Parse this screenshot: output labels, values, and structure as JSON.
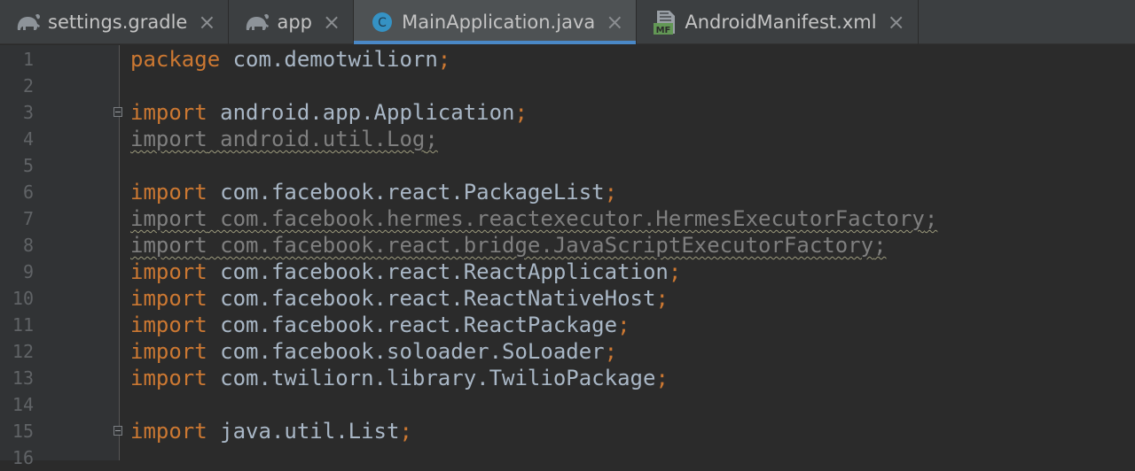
{
  "tabs": [
    {
      "label": "settings.gradle",
      "icon": "gradle-elephant-icon",
      "active": false
    },
    {
      "label": "app",
      "icon": "gradle-elephant-icon",
      "active": false
    },
    {
      "label": "MainApplication.java",
      "icon": "java-class-icon",
      "icon_text": "C",
      "active": true
    },
    {
      "label": "AndroidManifest.xml",
      "icon": "manifest-file-icon",
      "icon_text": "MF",
      "active": false
    }
  ],
  "colors": {
    "background": "#2b2b2b",
    "gutter": "#313335",
    "keyword": "#cc7832",
    "identifier": "#a9b7c6",
    "unused": "#7f7f7f",
    "line_number": "#606366",
    "active_tab_underline": "#4a88c7"
  },
  "editor": {
    "lines": [
      {
        "n": "1",
        "kw": "package",
        "id": " com.demotwiliorn",
        "punct": ";",
        "unused": false,
        "fold": false
      },
      {
        "n": "2",
        "kw": "",
        "id": "",
        "punct": "",
        "unused": false,
        "fold": false
      },
      {
        "n": "3",
        "kw": "import",
        "id": " android.app.Application",
        "punct": ";",
        "unused": false,
        "fold": true
      },
      {
        "n": "4",
        "kw": "import",
        "id": " android.util.Log",
        "punct": ";",
        "unused": true,
        "fold": false
      },
      {
        "n": "5",
        "kw": "",
        "id": "",
        "punct": "",
        "unused": false,
        "fold": false
      },
      {
        "n": "6",
        "kw": "import",
        "id": " com.facebook.react.PackageList",
        "punct": ";",
        "unused": false,
        "fold": false
      },
      {
        "n": "7",
        "kw": "import",
        "id": " com.facebook.hermes.reactexecutor.HermesExecutorFactory",
        "punct": ";",
        "unused": true,
        "fold": false
      },
      {
        "n": "8",
        "kw": "import",
        "id": " com.facebook.react.bridge.JavaScriptExecutorFactory",
        "punct": ";",
        "unused": true,
        "fold": false
      },
      {
        "n": "9",
        "kw": "import",
        "id": " com.facebook.react.ReactApplication",
        "punct": ";",
        "unused": false,
        "fold": false
      },
      {
        "n": "10",
        "kw": "import",
        "id": " com.facebook.react.ReactNativeHost",
        "punct": ";",
        "unused": false,
        "fold": false
      },
      {
        "n": "11",
        "kw": "import",
        "id": " com.facebook.react.ReactPackage",
        "punct": ";",
        "unused": false,
        "fold": false
      },
      {
        "n": "12",
        "kw": "import",
        "id": " com.facebook.soloader.SoLoader",
        "punct": ";",
        "unused": false,
        "fold": false
      },
      {
        "n": "13",
        "kw": "import",
        "id": " com.twiliorn.library.TwilioPackage",
        "punct": ";",
        "unused": false,
        "fold": false
      },
      {
        "n": "14",
        "kw": "",
        "id": "",
        "punct": "",
        "unused": false,
        "fold": false
      },
      {
        "n": "15",
        "kw": "import",
        "id": " java.util.List",
        "punct": ";",
        "unused": false,
        "fold": true
      },
      {
        "n": "16",
        "kw": "",
        "id": "",
        "punct": "",
        "unused": false,
        "fold": false
      }
    ]
  }
}
